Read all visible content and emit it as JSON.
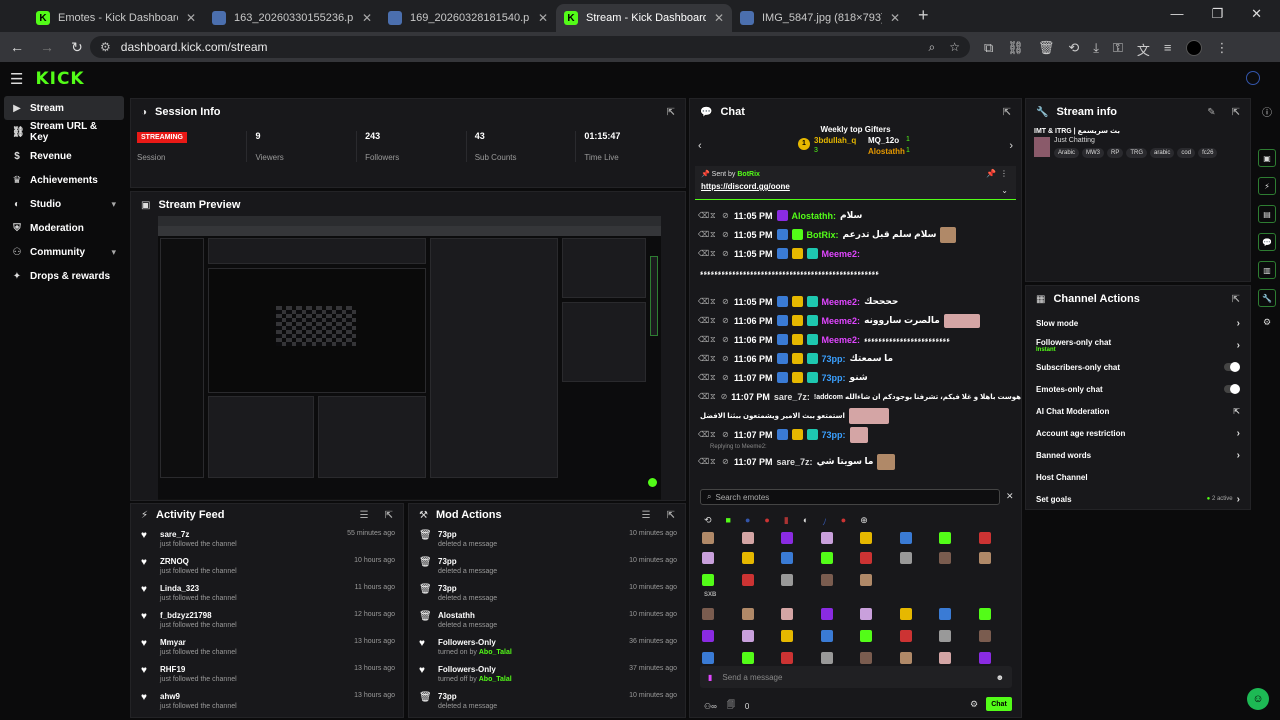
{
  "browser": {
    "tabs": [
      {
        "label": "Emotes - Kick Dashboard",
        "fav": "K",
        "active": false
      },
      {
        "label": "163_20260330155236.png (500×...",
        "fav": "",
        "active": false
      },
      {
        "label": "169_20260328181540.png (500×...",
        "fav": "",
        "active": false
      },
      {
        "label": "Stream - Kick Dashboard",
        "fav": "K",
        "active": true
      },
      {
        "label": "IMG_5847.jpg (818×793)",
        "fav": "",
        "active": false
      }
    ],
    "url": "dashboard.kick.com/stream"
  },
  "app": {
    "logo": "KICK"
  },
  "sidebar": {
    "items": [
      {
        "label": "Stream",
        "icon": "video-icon",
        "active": true,
        "chev": ""
      },
      {
        "label": "Stream URL & Key",
        "icon": "link-icon",
        "active": false,
        "chev": ""
      },
      {
        "label": "Revenue",
        "icon": "dollar-icon",
        "active": false,
        "chev": ""
      },
      {
        "label": "Achievements",
        "icon": "trophy-icon",
        "active": false,
        "chev": ""
      },
      {
        "label": "Studio",
        "icon": "studio-icon",
        "active": false,
        "chev": "▾"
      },
      {
        "label": "Moderation",
        "icon": "shield-icon",
        "active": false,
        "chev": ""
      },
      {
        "label": "Community",
        "icon": "people-icon",
        "active": false,
        "chev": "▾"
      },
      {
        "label": "Drops & rewards",
        "icon": "gift-icon",
        "active": false,
        "chev": ""
      }
    ]
  },
  "session": {
    "title": "Session Info",
    "status": "STREAMING",
    "stats": [
      {
        "value": "",
        "label": "Session"
      },
      {
        "value": "9",
        "label": "Viewers"
      },
      {
        "value": "243",
        "label": "Followers"
      },
      {
        "value": "43",
        "label": "Sub Counts"
      },
      {
        "value": "01:15:47",
        "label": "Time Live"
      }
    ]
  },
  "preview": {
    "title": "Stream Preview"
  },
  "activity": {
    "title": "Activity Feed",
    "items": [
      {
        "name": "sare_7z",
        "sub": "just followed the channel",
        "time": "55 minutes ago"
      },
      {
        "name": "ZRNOQ",
        "sub": "just followed the channel",
        "time": "10 hours ago"
      },
      {
        "name": "Linda_323",
        "sub": "just followed the channel",
        "time": "11 hours ago"
      },
      {
        "name": "f_bdzyz21798",
        "sub": "just followed the channel",
        "time": "12 hours ago"
      },
      {
        "name": "Mmyar",
        "sub": "just followed the channel",
        "time": "13 hours ago"
      },
      {
        "name": "RHF19",
        "sub": "just followed the channel",
        "time": "13 hours ago"
      },
      {
        "name": "ahw9",
        "sub": "just followed the channel",
        "time": "13 hours ago"
      }
    ]
  },
  "modactions": {
    "title": "Mod Actions",
    "items": [
      {
        "name": "73pp",
        "sub": "deleted a message",
        "by": "",
        "time": "10 minutes ago"
      },
      {
        "name": "73pp",
        "sub": "deleted a message",
        "by": "",
        "time": "10 minutes ago"
      },
      {
        "name": "73pp",
        "sub": "deleted a message",
        "by": "",
        "time": "10 minutes ago"
      },
      {
        "name": "Alostathh",
        "sub": "deleted a message",
        "by": "",
        "time": "10 minutes ago"
      },
      {
        "name": "Followers-Only",
        "sub": "turned on by",
        "by": "Abo_Talal",
        "time": "36 minutes ago"
      },
      {
        "name": "Followers-Only",
        "sub": "turned off by",
        "by": "Abo_Talal",
        "time": "37 minutes ago"
      },
      {
        "name": "73pp",
        "sub": "deleted a message",
        "by": "",
        "time": "10 minutes ago"
      }
    ]
  },
  "chat": {
    "title": "Chat",
    "gifters_title": "Weekly top Gifters",
    "gifters": [
      {
        "name": "3bdullah_q",
        "count": "3"
      },
      {
        "name": "MQ_12o",
        "count": "1"
      },
      {
        "name": "Alostathh",
        "count": "1"
      }
    ],
    "pinned_by_label": "Sent by",
    "pinned_by": "BotRix",
    "pinned_link": "https://discord.gg/oone",
    "messages": [
      {
        "time": "11:05 PM",
        "user": "Alostathh:",
        "color": "#53fc18",
        "text": "سلام"
      },
      {
        "time": "11:05 PM",
        "user": "BotRix:",
        "color": "#53fc18",
        "text": "سلام سلم قبل تدرعم"
      },
      {
        "time": "11:05 PM",
        "user": "Meeme2:",
        "color": "#e046ff",
        "text": ""
      },
      {
        "time": "",
        "user": "",
        "color": "#fff",
        "text": "ءءءءءءءءءءءءءءءءءءءءءءءءءءءءءءءءءءءءءءءءءءءءءءءءءء"
      },
      {
        "time": "11:05 PM",
        "user": "Meeme2:",
        "color": "#e046ff",
        "text": "ححححك"
      },
      {
        "time": "11:06 PM",
        "user": "Meeme2:",
        "color": "#e046ff",
        "text": "مالصرت ساروونه"
      },
      {
        "time": "11:06 PM",
        "user": "Meeme2:",
        "color": "#e046ff",
        "text": "ءءءءءءءءءءءءءءءءءءءءءءءء"
      },
      {
        "time": "11:06 PM",
        "user": "73pp:",
        "color": "#3aa0ff",
        "text": "ما سمعتك"
      },
      {
        "time": "11:07 PM",
        "user": "73pp:",
        "color": "#3aa0ff",
        "text": "شنو"
      },
      {
        "time": "11:07 PM",
        "user": "sare_7z:",
        "color": "#ddd",
        "text": "!addcom هوست باهلا و غلا فيكم، تشرفنا بوجودكم ان شاءالله"
      },
      {
        "time": "",
        "user": "",
        "color": "#fff",
        "text": "استمتعو ببث الامير ويشمتعون ببثنا الافضل"
      },
      {
        "time": "11:07 PM",
        "user": "73pp:",
        "color": "#3aa0ff",
        "text": ""
      },
      {
        "time": "11:07 PM",
        "user": "sare_7z:",
        "color": "#ddd",
        "text": "ما سويتا شي"
      }
    ],
    "replying": "Replying to Meeme2:",
    "search_placeholder": "Search emotes",
    "section_label": "SXB",
    "send_placeholder": "Send a message",
    "send_button": "Chat",
    "viewer_count": "0"
  },
  "streaminfo": {
    "title": "Stream info",
    "stream_title": "IMT & ITRG | بث سريسمع",
    "category": "Just Chatting",
    "tags": [
      "Arabic",
      "MW3",
      "RP",
      "TRG",
      "arabic",
      "cod",
      "fc26"
    ]
  },
  "actions": {
    "title": "Channel Actions",
    "items": [
      {
        "label": "Slow mode",
        "sub": "",
        "ctrl": "chev"
      },
      {
        "label": "Followers-only chat",
        "sub": "Instant",
        "ctrl": "chev"
      },
      {
        "label": "Subscribers-only chat",
        "sub": "",
        "ctrl": "toggle"
      },
      {
        "label": "Emotes-only chat",
        "sub": "",
        "ctrl": "toggle"
      },
      {
        "label": "AI Chat Moderation",
        "sub": "",
        "ctrl": "pop"
      },
      {
        "label": "Account age restriction",
        "sub": "",
        "ctrl": "chev"
      },
      {
        "label": "Banned words",
        "sub": "",
        "ctrl": "chev"
      },
      {
        "label": "Host Channel",
        "sub": "",
        "ctrl": ""
      },
      {
        "label": "Set goals",
        "sub": "",
        "ctrl": "chev",
        "badge": "2 active"
      }
    ]
  },
  "colors": {
    "accent": "#53fc18",
    "live": "#e91916",
    "panel": "#18181b"
  }
}
